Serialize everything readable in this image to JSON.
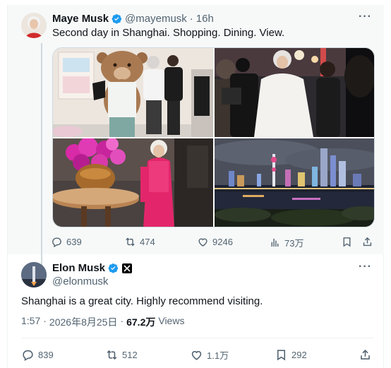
{
  "quoted_post": {
    "author_name": "Maye Musk",
    "author_handle": "@mayemusk",
    "separator": "·",
    "time": "16h",
    "text": "Second day in Shanghai. Shopping. Dining. View.",
    "media": [
      {
        "icon": "photo-teddy-bear-shop"
      },
      {
        "icon": "photo-crowd-street"
      },
      {
        "icon": "photo-pink-outfit-flowers"
      },
      {
        "icon": "photo-shanghai-skyline-night"
      }
    ],
    "stats": {
      "replies": "639",
      "reposts": "474",
      "likes": "9246",
      "views": "73万"
    }
  },
  "main_post": {
    "author_name": "Elon Musk",
    "author_handle": "@elonmusk",
    "text": "Shanghai is a great city. Highly recommend visiting.",
    "time": "1:57",
    "separator": "·",
    "date": "2026年8月25日",
    "separator2": "·",
    "views_count": "67.2万",
    "views_label": "Views",
    "stats": {
      "replies": "839",
      "reposts": "512",
      "likes": "1.1万",
      "bookmarks": "292"
    }
  },
  "more_label": "···",
  "colors": {
    "verified_blue": "#1d9bf0",
    "text_secondary": "#536471",
    "quoted_background": "#f7f9f9"
  }
}
